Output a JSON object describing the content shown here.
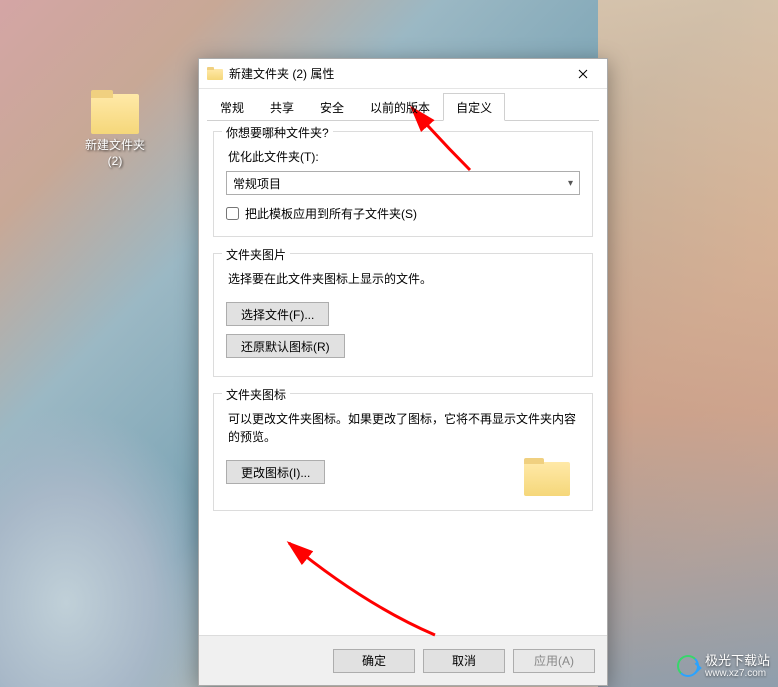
{
  "desktop": {
    "icon_label": "新建文件夹\n(2)"
  },
  "dialog": {
    "title": "新建文件夹 (2) 属性",
    "tabs": [
      "常规",
      "共享",
      "安全",
      "以前的版本",
      "自定义"
    ],
    "active_tab_index": 4,
    "group1": {
      "legend": "你想要哪种文件夹?",
      "optimize_label": "优化此文件夹(T):",
      "dropdown_value": "常规项目",
      "checkbox_label": "把此模板应用到所有子文件夹(S)"
    },
    "group2": {
      "legend": "文件夹图片",
      "desc": "选择要在此文件夹图标上显示的文件。",
      "btn_choose": "选择文件(F)...",
      "btn_restore": "还原默认图标(R)"
    },
    "group3": {
      "legend": "文件夹图标",
      "desc": "可以更改文件夹图标。如果更改了图标，它将不再显示文件夹内容的预览。",
      "btn_change": "更改图标(I)..."
    },
    "footer": {
      "ok": "确定",
      "cancel": "取消",
      "apply": "应用(A)"
    }
  },
  "watermark": {
    "line1": "极光下载站",
    "line2": "www.xz7.com"
  }
}
